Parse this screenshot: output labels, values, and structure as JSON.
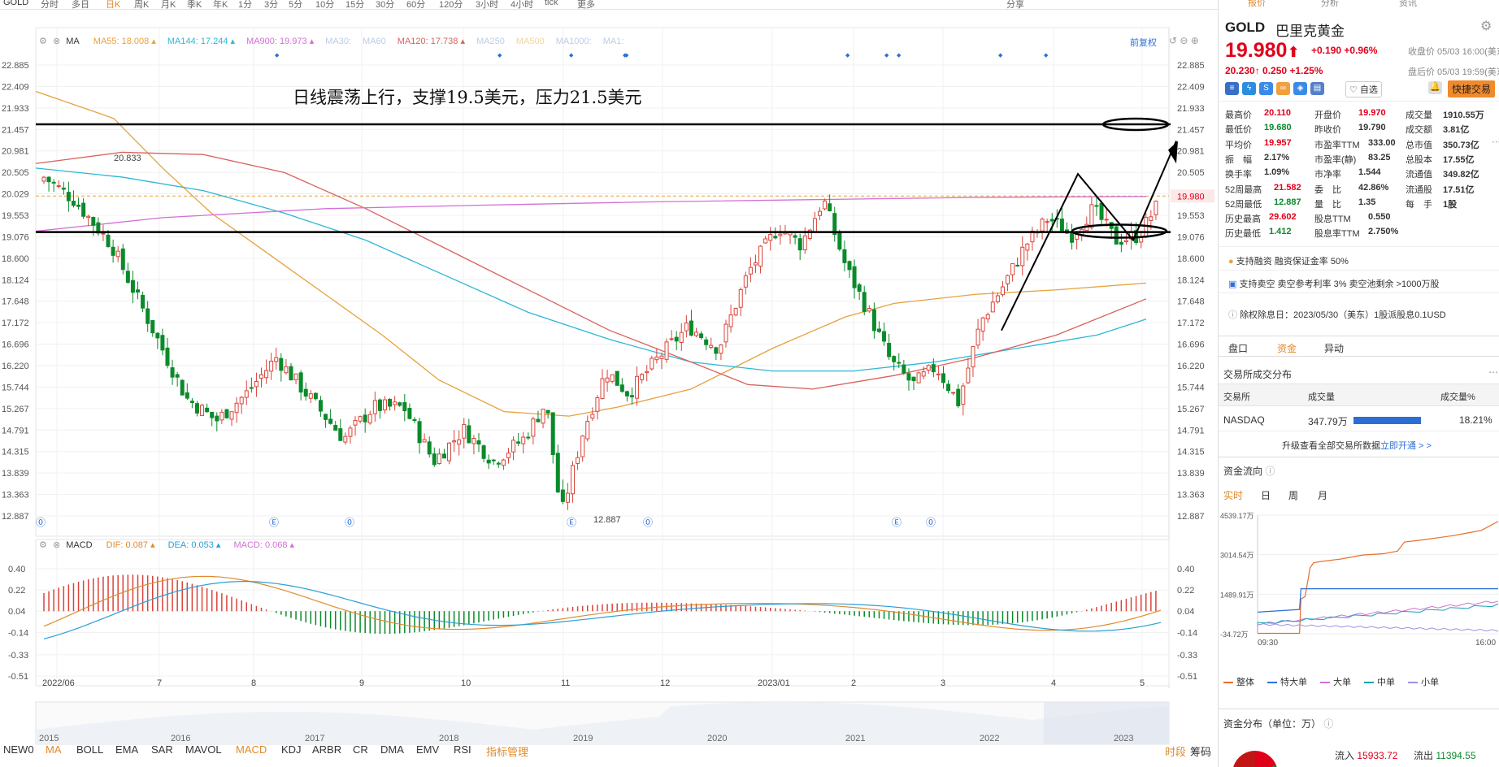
{
  "toolbar": {
    "left_items": [
      "GOLD",
      "分时",
      "多日",
      "日K",
      "周K",
      "月K",
      "季K",
      "年K",
      "1分",
      "3分",
      "5分",
      "10分",
      "15分",
      "30分",
      "60分",
      "120分",
      "3小时",
      "4小时",
      "tick",
      "更多"
    ],
    "right_items": [
      "分享"
    ],
    "tabs": [
      "报价",
      "分析",
      "资讯"
    ]
  },
  "main_chart": {
    "ma_label": "MA",
    "indicators": [
      {
        "name": "MA55:",
        "value": "18.008",
        "color": "#e6a23c"
      },
      {
        "name": "MA144:",
        "value": "17.244",
        "color": "#2db7d6"
      },
      {
        "name": "MA900:",
        "value": "19.973",
        "color": "#d36fd6"
      },
      {
        "name": "MA30:",
        "value": "",
        "color": "#b8cde8"
      },
      {
        "name": "MA60",
        "value": "",
        "color": "#b8cde8"
      },
      {
        "name": "MA120:",
        "value": "17.738",
        "color": "#d9625e"
      },
      {
        "name": "MA250",
        "value": "",
        "color": "#b8cde8"
      },
      {
        "name": "MA500",
        "value": "",
        "color": "#f2d49a"
      },
      {
        "name": "MA1000:",
        "value": "",
        "color": "#b8cde8"
      },
      {
        "name": "MA1:",
        "value": "",
        "color": "#b8cde8"
      }
    ],
    "adjust_label": "前复权",
    "annotation_text": "日线震荡上行，支撑19.5美元，压力21.5美元",
    "price_ticks": [
      "22.885",
      "22.409",
      "21.933",
      "21.457",
      "20.981",
      "20.505",
      "20.029",
      "19.553",
      "19.076",
      "18.600",
      "18.124",
      "17.648",
      "17.172",
      "16.696",
      "16.220",
      "15.744",
      "15.267",
      "14.791",
      "14.315",
      "13.839",
      "13.363",
      "12.887"
    ],
    "current_price_tag": "19.980",
    "high_label": "20.833",
    "low_label": "12.887",
    "ymin": 12.887,
    "ymax": 22.885
  },
  "macd": {
    "name": "MACD",
    "values": [
      {
        "name": "DIF:",
        "value": "0.087",
        "color": "#e08a2c"
      },
      {
        "name": "DEA:",
        "value": "0.053",
        "color": "#2b9ed6"
      },
      {
        "name": "MACD:",
        "value": "0.068",
        "color": "#d36fd6"
      }
    ],
    "ticks": [
      "0.40",
      "0.22",
      "0.04",
      "-0.14",
      "-0.33",
      "-0.51"
    ]
  },
  "x_labels": [
    "2022/06",
    "7",
    "8",
    "9",
    "10",
    "11",
    "12",
    "2023/01",
    "2",
    "3",
    "4",
    "5"
  ],
  "overview_years": [
    "2015",
    "2016",
    "2017",
    "2018",
    "2019",
    "2020",
    "2021",
    "2022",
    "2023"
  ],
  "indicator_tabs": [
    "NEW0",
    "MA",
    "BOLL",
    "EMA",
    "SAR",
    "MAVOL",
    "MACD",
    "KDJ",
    "ARBR",
    "CR",
    "DMA",
    "EMV",
    "RSI",
    "指标管理"
  ],
  "bottom_right": [
    "时段",
    "筹码"
  ],
  "quote": {
    "symbol": "GOLD",
    "name": "巴里克黄金",
    "price": "19.980",
    "arrow": "⬆",
    "change": "+0.190",
    "change_pct": "+0.96%",
    "close_label": "收盘价 05/03 16:00(美东)",
    "ah_price": "20.230",
    "ah_arrow": "↑",
    "ah_change": "0.250",
    "ah_pct": "+1.25%",
    "ah_label": "盘后价 05/03 19:59(美东)",
    "watch_label": "自选",
    "trade_label": "快捷交易",
    "stats": [
      [
        {
          "k": "最高价",
          "v": "20.110",
          "c": "red"
        },
        {
          "k": "开盘价",
          "v": "19.970",
          "c": "red"
        },
        {
          "k": "成交量",
          "v": "1910.55万",
          "c": "bold"
        }
      ],
      [
        {
          "k": "最低价",
          "v": "19.680",
          "c": "green"
        },
        {
          "k": "昨收价",
          "v": "19.790",
          "c": ""
        },
        {
          "k": "成交额",
          "v": "3.81亿",
          "c": "bold"
        }
      ],
      [
        {
          "k": "平均价",
          "v": "19.957",
          "c": "red"
        },
        {
          "k": "市盈率TTM",
          "v": "333.00",
          "c": "bold"
        },
        {
          "k": "总市值",
          "v": "350.73亿",
          "c": "bold"
        }
      ],
      [
        {
          "k": "振　幅",
          "v": "2.17%",
          "c": "bold"
        },
        {
          "k": "市盈率(静)",
          "v": "83.25",
          "c": "bold"
        },
        {
          "k": "总股本",
          "v": "17.55亿",
          "c": "bold"
        }
      ],
      [
        {
          "k": "换手率",
          "v": "1.09%",
          "c": "bold"
        },
        {
          "k": "市净率",
          "v": "1.544",
          "c": "bold"
        },
        {
          "k": "流通值",
          "v": "349.82亿",
          "c": "bold"
        }
      ],
      [
        {
          "k": "52周最高",
          "v": "21.582",
          "c": "red"
        },
        {
          "k": "委　比",
          "v": "42.86%",
          "c": "bold"
        },
        {
          "k": "流通股",
          "v": "17.51亿",
          "c": "bold"
        }
      ],
      [
        {
          "k": "52周最低",
          "v": "12.887",
          "c": "green"
        },
        {
          "k": "量　比",
          "v": "1.35",
          "c": "bold"
        },
        {
          "k": "每　手",
          "v": "1股",
          "c": "bold"
        }
      ],
      [
        {
          "k": "历史最高",
          "v": "29.602",
          "c": "red"
        },
        {
          "k": "股息TTM",
          "v": "0.550",
          "c": "bold"
        },
        {
          "k": "",
          "v": "",
          "c": ""
        }
      ],
      [
        {
          "k": "历史最低",
          "v": "1.412",
          "c": "green"
        },
        {
          "k": "股息率TTM",
          "v": "2.750%",
          "c": "bold"
        },
        {
          "k": "",
          "v": "",
          "c": ""
        }
      ]
    ],
    "margin_text": "支持融资 融资保证金率 50%",
    "short_text": "支持卖空 卖空参考利率 3% 卖空池剩余 >1000万股",
    "ex_div_text": "除权除息日：2023/05/30（美东）1股派股息0.1USD"
  },
  "funds": {
    "tabs": [
      "盘口",
      "资金",
      "异动"
    ],
    "dist_title": "交易所成交分布",
    "table_headers": [
      "交易所",
      "成交量",
      "成交量%"
    ],
    "row": {
      "exchange": "NASDAQ",
      "volume": "347.79万",
      "pct": "18.21%",
      "bar": 0.18
    },
    "upgrade_text": "升级查看全部交易所数据",
    "upgrade_link": "立即开通 > >",
    "flow_title": "资金流向",
    "periods": [
      "实时",
      "日",
      "周",
      "月"
    ],
    "flow_ticks": [
      "4539.17万",
      "3014.54万",
      "1489.91万",
      "-34.72万"
    ],
    "time_labels": [
      "09:30",
      "16:00"
    ],
    "legend": [
      {
        "name": "整体",
        "color": "#e66d2a"
      },
      {
        "name": "特大单",
        "color": "#2b6fd6"
      },
      {
        "name": "大单",
        "color": "#d36fd6"
      },
      {
        "name": "中单",
        "color": "#17a2b8"
      },
      {
        "name": "小单",
        "color": "#a38fe0"
      }
    ],
    "dist2_title": "资金分布（单位：万）",
    "inflow_label": "流入",
    "inflow": "15933.72",
    "outflow_label": "流出",
    "outflow": "11394.55"
  }
}
